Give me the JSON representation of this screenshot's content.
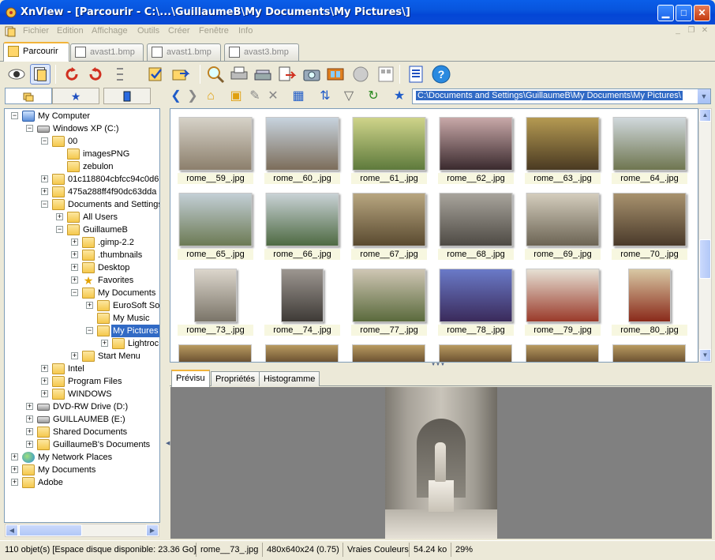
{
  "window": {
    "title": "XnView - [Parcourir - C:\\...\\GuillaumeB\\My Documents\\My Pictures\\]",
    "minimize_glyph": "▁",
    "maximize_glyph": "□",
    "close_glyph": "✕"
  },
  "menu": [
    "Fichier",
    "Edition",
    "Affichage",
    "Outils",
    "Créer",
    "Fenêtre",
    "Info"
  ],
  "tabs": [
    {
      "label": "Parcourir",
      "active": true
    },
    {
      "label": "avast1.bmp",
      "active": false
    },
    {
      "label": "avast1.bmp",
      "active": false
    },
    {
      "label": "avast3.bmp",
      "active": false
    }
  ],
  "path": {
    "value": "C:\\Documents and Settings\\GuillaumeB\\My Documents\\My Pictures\\",
    "dropdown_glyph": "▼"
  },
  "tree": [
    {
      "label": "My Computer",
      "level": 0,
      "expander": "−",
      "icon": "computer"
    },
    {
      "label": "Windows XP (C:)",
      "level": 1,
      "expander": "−",
      "icon": "drive"
    },
    {
      "label": "00",
      "level": 2,
      "expander": "−",
      "icon": "folder"
    },
    {
      "label": "imagesPNG",
      "level": 3,
      "expander": "",
      "icon": "folder"
    },
    {
      "label": "zebulon",
      "level": 3,
      "expander": "",
      "icon": "folder"
    },
    {
      "label": "01c118804cbfcc94c0d6",
      "level": 2,
      "expander": "+",
      "icon": "folder"
    },
    {
      "label": "475a288ff4f90dc63dda",
      "level": 2,
      "expander": "+",
      "icon": "folder"
    },
    {
      "label": "Documents and Settings",
      "level": 2,
      "expander": "−",
      "icon": "folder"
    },
    {
      "label": "All Users",
      "level": 3,
      "expander": "+",
      "icon": "folder"
    },
    {
      "label": "GuillaumeB",
      "level": 3,
      "expander": "−",
      "icon": "folder"
    },
    {
      "label": ".gimp-2.2",
      "level": 4,
      "expander": "+",
      "icon": "folder"
    },
    {
      "label": ".thumbnails",
      "level": 4,
      "expander": "+",
      "icon": "folder"
    },
    {
      "label": "Desktop",
      "level": 4,
      "expander": "+",
      "icon": "folder"
    },
    {
      "label": "Favorites",
      "level": 4,
      "expander": "+",
      "icon": "star"
    },
    {
      "label": "My Documents",
      "level": 4,
      "expander": "−",
      "icon": "folder"
    },
    {
      "label": "EuroSoft So",
      "level": 5,
      "expander": "+",
      "icon": "folder"
    },
    {
      "label": "My Music",
      "level": 5,
      "expander": "",
      "icon": "folder"
    },
    {
      "label": "My Pictures",
      "level": 5,
      "expander": "−",
      "icon": "folder",
      "selected": true
    },
    {
      "label": "Lightroc",
      "level": 6,
      "expander": "+",
      "icon": "folder"
    },
    {
      "label": "Start Menu",
      "level": 4,
      "expander": "+",
      "icon": "folder"
    },
    {
      "label": "Intel",
      "level": 2,
      "expander": "+",
      "icon": "folder"
    },
    {
      "label": "Program Files",
      "level": 2,
      "expander": "+",
      "icon": "folder"
    },
    {
      "label": "WINDOWS",
      "level": 2,
      "expander": "+",
      "icon": "folder"
    },
    {
      "label": "DVD-RW Drive (D:)",
      "level": 1,
      "expander": "+",
      "icon": "drive"
    },
    {
      "label": "GUILLAUMEB (E:)",
      "level": 1,
      "expander": "+",
      "icon": "drive"
    },
    {
      "label": "Shared Documents",
      "level": 1,
      "expander": "+",
      "icon": "folder"
    },
    {
      "label": "GuillaumeB's Documents",
      "level": 1,
      "expander": "+",
      "icon": "folder"
    },
    {
      "label": "My Network Places",
      "level": 0,
      "expander": "+",
      "icon": "globe"
    },
    {
      "label": "My Documents",
      "level": 0,
      "expander": "+",
      "icon": "folder"
    },
    {
      "label": "Adobe",
      "level": 0,
      "expander": "+",
      "icon": "folder"
    }
  ],
  "thumbnails": [
    {
      "name": "rome__59_.jpg",
      "c1": "#d6d2c8",
      "c2": "#8c7f6c",
      "portrait": false
    },
    {
      "name": "rome__60_.jpg",
      "c1": "#c7d3de",
      "c2": "#7c6d5a",
      "portrait": false
    },
    {
      "name": "rome__61_.jpg",
      "c1": "#cfd48a",
      "c2": "#5e7a3c",
      "portrait": false
    },
    {
      "name": "rome__62_.jpg",
      "c1": "#c8a8a8",
      "c2": "#3a2a2e",
      "portrait": false
    },
    {
      "name": "rome__63_.jpg",
      "c1": "#b59a52",
      "c2": "#4a3a22",
      "portrait": false
    },
    {
      "name": "rome__64_.jpg",
      "c1": "#d0d8dc",
      "c2": "#6f7650",
      "portrait": false
    },
    {
      "name": "rome__65_.jpg",
      "c1": "#c3cfd6",
      "c2": "#6c7a54",
      "portrait": false
    },
    {
      "name": "rome__66_.jpg",
      "c1": "#c9d2d6",
      "c2": "#4e6a42",
      "portrait": false
    },
    {
      "name": "rome__67_.jpg",
      "c1": "#b8a680",
      "c2": "#5a4a30",
      "portrait": false
    },
    {
      "name": "rome__68_.jpg",
      "c1": "#a8a49c",
      "c2": "#4e4a44",
      "portrait": false
    },
    {
      "name": "rome__69_.jpg",
      "c1": "#d4cdbd",
      "c2": "#6c6454",
      "portrait": false
    },
    {
      "name": "rome__70_.jpg",
      "c1": "#a8926e",
      "c2": "#4a3a2a",
      "portrait": false
    },
    {
      "name": "rome__73_.jpg",
      "c1": "#dcd6cc",
      "c2": "#7a7468",
      "portrait": true
    },
    {
      "name": "rome__74_.jpg",
      "c1": "#9c9690",
      "c2": "#3e3a36",
      "portrait": true
    },
    {
      "name": "rome__77_.jpg",
      "c1": "#cfc6b4",
      "c2": "#5a6a3c",
      "portrait": false
    },
    {
      "name": "rome__78_.jpg",
      "c1": "#6a7ac8",
      "c2": "#3a2a5a",
      "portrait": false
    },
    {
      "name": "rome__79_.jpg",
      "c1": "#e6e0d4",
      "c2": "#9a3a2a",
      "portrait": false
    },
    {
      "name": "rome__80_.jpg",
      "c1": "#d8c8a4",
      "c2": "#8a2a1a",
      "portrait": true
    }
  ],
  "preview_tabs": [
    {
      "label": "Prévisu",
      "active": true
    },
    {
      "label": "Propriétés",
      "active": false
    },
    {
      "label": "Histogramme",
      "active": false
    }
  ],
  "status": {
    "objects": "110 objet(s) [Espace disque disponible: 23.36 Go]",
    "filename": "rome__73_.jpg",
    "dimensions": "480x640x24 (0.75)",
    "colors": "Vraies Couleurs",
    "size": "54.24 ko",
    "zoom": "29%"
  },
  "colors": {
    "accent": "#316ac5",
    "titlebar": "#0a5ee9",
    "tab_highlight": "#f2b43a"
  }
}
